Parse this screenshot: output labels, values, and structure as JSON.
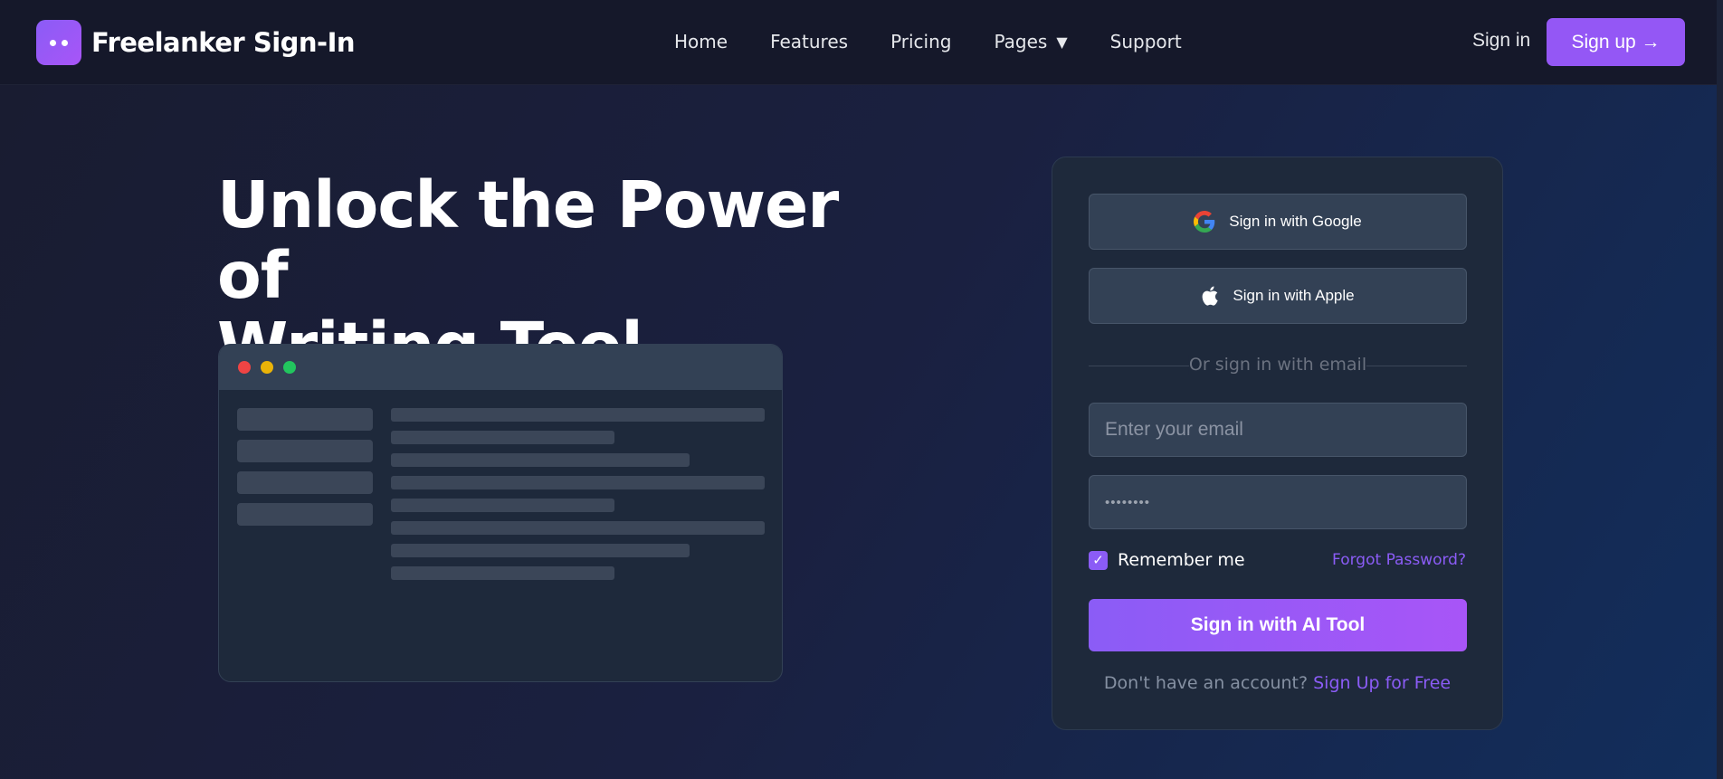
{
  "brand": {
    "title": "Freelanker Sign-In",
    "logo_icon": "chat-bubble-dots-icon",
    "accent": "#8b5cf6"
  },
  "nav": {
    "items": [
      {
        "label": "Home"
      },
      {
        "label": "Features"
      },
      {
        "label": "Pricing"
      },
      {
        "label": "Pages",
        "caret": "▼"
      },
      {
        "label": "Support"
      }
    ],
    "signin_label": "Sign in",
    "signup_label": "Sign up →"
  },
  "hero": {
    "title_line1": "Unlock the Power of",
    "title_line2": "Writing Tool"
  },
  "form": {
    "google_label": "Sign in with Google",
    "apple_label": "Sign in with Apple",
    "divider_text": "Or sign in with email",
    "email_placeholder": "Enter your email",
    "password_value": "••••••••",
    "remember_label": "Remember me",
    "remember_checked": true,
    "checkmark": "✓",
    "forgot_label": "Forgot Password?",
    "submit_label": "Sign in with AI Tool",
    "no_account_text": "Don't have an account?",
    "signup_free_label": "Sign Up for Free"
  },
  "colors": {
    "background_start": "#191c30",
    "background_end": "#122e5c",
    "card": "#1e293b",
    "button_gradient_start": "#8b5cf6",
    "button_gradient_end": "#a855f7",
    "window_dot_red": "#ef4444",
    "window_dot_yellow": "#eab308",
    "window_dot_green": "#22c55e"
  }
}
